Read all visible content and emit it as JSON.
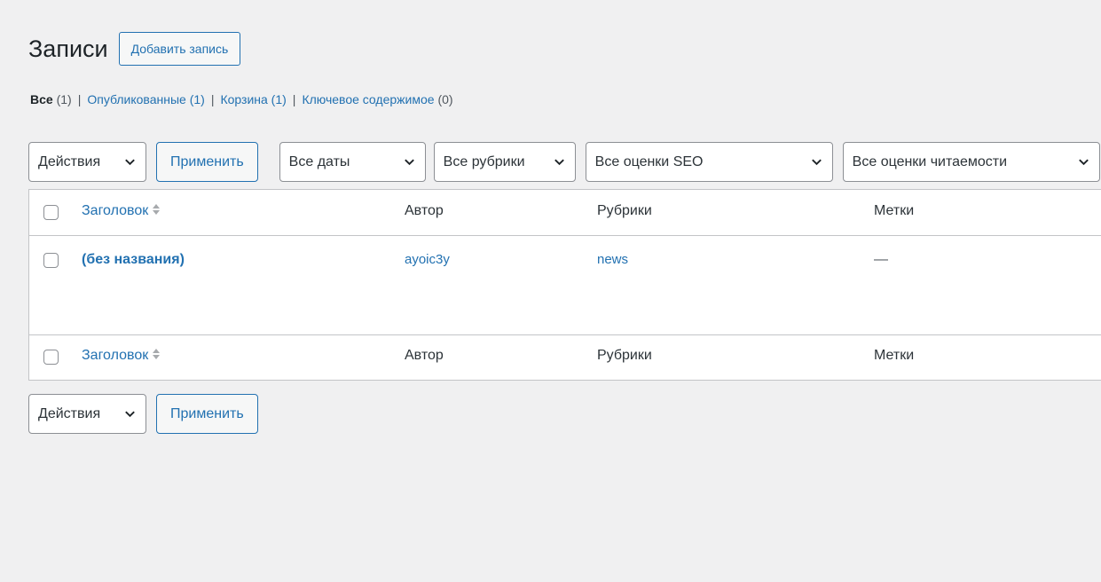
{
  "header": {
    "title": "Записи",
    "add_new_label": "Добавить запись"
  },
  "views": [
    {
      "label": "Все",
      "count": "(1)",
      "current": true
    },
    {
      "label": "Опубликованные",
      "count": "(1)"
    },
    {
      "label": "Корзина",
      "count": "(1)"
    },
    {
      "label": "Ключевое содержимое",
      "count": "(0)"
    }
  ],
  "views_separator": "|",
  "filters": {
    "bulk_actions": "Действия",
    "apply_label": "Применить",
    "dates": "Все даты",
    "categories": "Все рубрики",
    "seo_scores": "Все оценки SEO",
    "readability_scores": "Все оценки читаемости"
  },
  "table": {
    "columns": {
      "title": "Заголовок",
      "author": "Автор",
      "categories": "Рубрики",
      "tags": "Метки"
    },
    "rows": [
      {
        "title": "(без названия)",
        "author": "ayoic3y",
        "categories": "news",
        "tags": "—"
      }
    ]
  },
  "bottom_nav": {
    "bulk_actions": "Действия",
    "apply_label": "Применить"
  },
  "colors": {
    "link": "#2271b1",
    "background": "#f0f0f1",
    "border": "#c3c4c7"
  }
}
